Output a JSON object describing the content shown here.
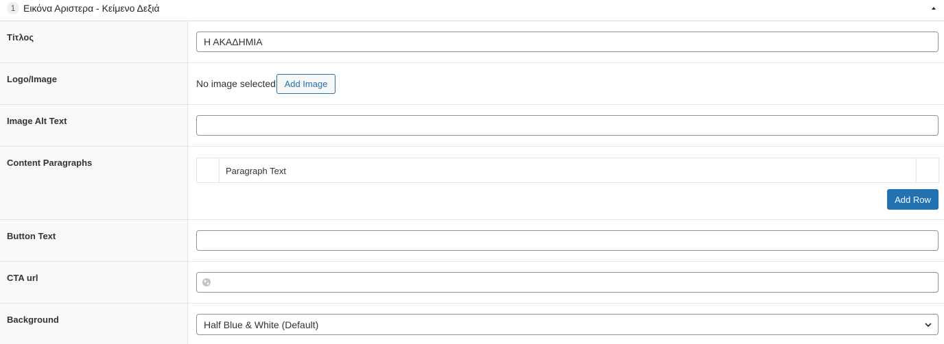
{
  "layout": {
    "order": "1",
    "title": "Εικόνα Αριστερα - Κείμενο Δεξιά"
  },
  "fields": {
    "title": {
      "label": "Τίτλος",
      "value": "Η ΑΚΑΔΗΜΙΑ"
    },
    "image": {
      "label": "Logo/Image",
      "empty_text": "No image selected",
      "add_label": "Add Image"
    },
    "alt_text": {
      "label": "Image Alt Text",
      "value": ""
    },
    "paragraphs": {
      "label": "Content Paragraphs",
      "column_heading": "Paragraph Text",
      "add_row_label": "Add Row"
    },
    "button_text": {
      "label": "Button Text",
      "value": ""
    },
    "cta_url": {
      "label": "CTA url",
      "value": ""
    },
    "background": {
      "label": "Background",
      "selected": "Half Blue & White (Default)"
    }
  },
  "colors": {
    "primary": "#2271b1",
    "label_bg": "#f9f9f9",
    "border": "#e5e5e5"
  }
}
